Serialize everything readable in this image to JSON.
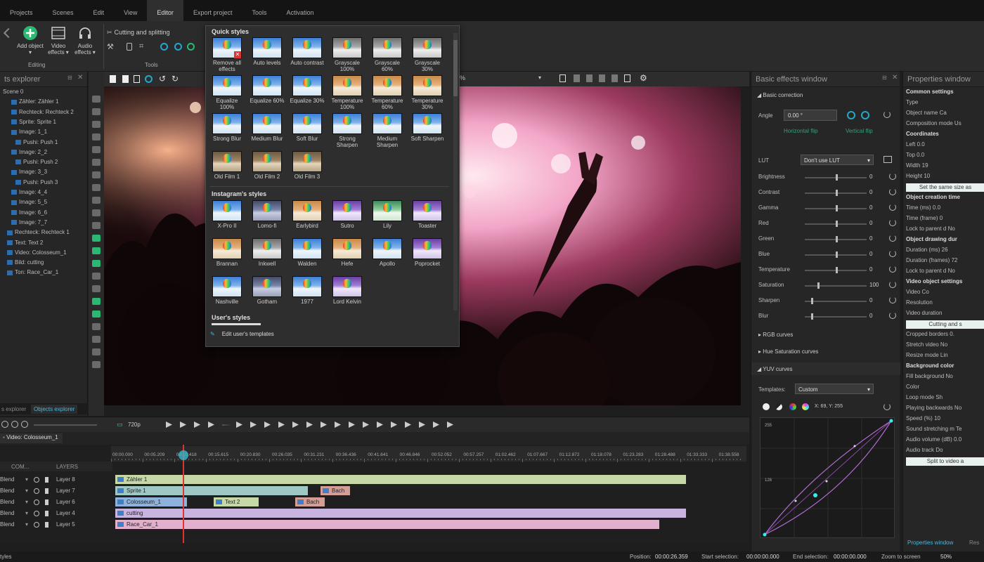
{
  "menu": [
    "Projects",
    "Scenes",
    "Edit",
    "View",
    "Editor",
    "Export project",
    "Tools",
    "Activation"
  ],
  "menu_active": "Editor",
  "ribbon": {
    "add_object": "Add object ▾",
    "video_effects": "Video effects ▾",
    "audio_effects": "Audio effects ▾",
    "editing_label": "Editing",
    "cutting_label": "Cutting and splitting",
    "tools_label": "Tools"
  },
  "scene_panel": {
    "title": "ts explorer",
    "items": [
      "Scene 0",
      "Zähler: Zähler 1",
      "Rechteck: Rechteck 2",
      "Sprite: Sprite 1",
      "Image: 1_1",
      "Pushi: Push 1",
      "Image: 2_2",
      "Pushi: Push 2",
      "Image: 3_3",
      "Pushi: Push 3",
      "Image: 4_4",
      "Image: 5_5",
      "Image: 6_6",
      "Image: 7_7",
      "Rechteck: Rechteck 1",
      "Text: Text 2",
      "Video: Colosseum_1",
      "Bild: cutting",
      "Ton: Race_Car_1"
    ],
    "tabs": [
      "s explorer",
      "Objects explorer"
    ]
  },
  "popup": {
    "quick_title": "Quick styles",
    "quick": [
      "Remove all effects",
      "Auto levels",
      "Auto contrast",
      "Grayscale 100%",
      "Grayscale 60%",
      "Grayscale 30%",
      "Equalize 100%",
      "Equalize 60%",
      "Equalize 30%",
      "Temperature 100%",
      "Temperature 60%",
      "Temperature 30%",
      "Strong Blur",
      "Medium Blur",
      "Soft Blur",
      "Strong Sharpen",
      "Medium Sharpen",
      "Soft Sharpen",
      "Old Film 1",
      "Old Film 2",
      "Old Film 3"
    ],
    "insta_title": "Instagram's styles",
    "insta": [
      "X-Pro II",
      "Lomo-fi",
      "Earlybird",
      "Sutro",
      "Lily",
      "Toaster",
      "Brannan",
      "Inkwell",
      "Walden",
      "Hefe",
      "Apollo",
      "Poprocket",
      "Nashville",
      "Gotham",
      "1977",
      "Lord Kelvin"
    ],
    "user_title": "User's styles",
    "edit_templates": "Edit user's templates"
  },
  "basic_effects": {
    "title": "Basic effects window",
    "section": "Basic correction",
    "angle_label": "Angle",
    "angle_value": "0.00 °",
    "horizontal_flip": "Horizontal flip",
    "vertical_flip": "Vertical flip",
    "lut_label": "LUT",
    "lut_value": "Don't use LUT",
    "sliders": [
      {
        "label": "Brightness",
        "value": "0",
        "pos": 0.5
      },
      {
        "label": "Contrast",
        "value": "0",
        "pos": 0.5
      },
      {
        "label": "Gamma",
        "value": "0",
        "pos": 0.5
      },
      {
        "label": "Red",
        "value": "0",
        "pos": 0.5
      },
      {
        "label": "Green",
        "value": "0",
        "pos": 0.5
      },
      {
        "label": "Blue",
        "value": "0",
        "pos": 0.5
      },
      {
        "label": "Temperature",
        "value": "0",
        "pos": 0.5
      },
      {
        "label": "Saturation",
        "value": "100",
        "pos": 0.2
      },
      {
        "label": "Sharpen",
        "value": "0",
        "pos": 0.1
      },
      {
        "label": "Blur",
        "value": "0",
        "pos": 0.1
      }
    ],
    "rgb_curves": "RGB curves",
    "hue_sat": "Hue Saturation curves",
    "yuv_curves": "YUV curves",
    "templates_label": "Templates:",
    "templates_value": "Custom",
    "coord": "X: 69, Y: 255",
    "curve_top": "255",
    "curve_mid": "128"
  },
  "properties": {
    "title": "Properties window",
    "rows": [
      {
        "t": "Common settings",
        "k": "hd"
      },
      {
        "t": "Type",
        "k": ""
      },
      {
        "t": "Object name     Ca",
        "k": ""
      },
      {
        "t": "Composition mode  Us",
        "k": ""
      },
      {
        "t": "Coordinates",
        "k": "hd"
      },
      {
        "t": "Left            0.0",
        "k": ""
      },
      {
        "t": "Top             0.0",
        "k": ""
      },
      {
        "t": "Width           19",
        "k": ""
      },
      {
        "t": "Height          10",
        "k": ""
      },
      {
        "t": "Set the same size as",
        "k": "btn"
      },
      {
        "t": "Object creation time",
        "k": "hd"
      },
      {
        "t": "Time (ms)       0.0",
        "k": ""
      },
      {
        "t": "Time (frame)    0",
        "k": ""
      },
      {
        "t": "Lock to parent d  No",
        "k": ""
      },
      {
        "t": "Object drawing dur",
        "k": "hd"
      },
      {
        "t": "Duration (ms)   26",
        "k": ""
      },
      {
        "t": "Duration (frames)  72",
        "k": ""
      },
      {
        "t": "Lock to parent d  No",
        "k": ""
      },
      {
        "t": "Video object settings",
        "k": "hd"
      },
      {
        "t": "Video           Co",
        "k": ""
      },
      {
        "t": "Resolution",
        "k": ""
      },
      {
        "t": "Video duration",
        "k": ""
      },
      {
        "t": "Cutting and s",
        "k": "btn"
      },
      {
        "t": "Cropped borders  0.",
        "k": ""
      },
      {
        "t": "Stretch video   No",
        "k": ""
      },
      {
        "t": "Resize mode     Lin",
        "k": ""
      },
      {
        "t": "Background color",
        "k": "hd"
      },
      {
        "t": "Fill background  No",
        "k": ""
      },
      {
        "t": "Color",
        "k": ""
      },
      {
        "t": "Loop mode       Sh",
        "k": ""
      },
      {
        "t": "Playing backwards  No",
        "k": ""
      },
      {
        "t": "Speed (%)       10",
        "k": ""
      },
      {
        "t": "Sound stretching m  Te",
        "k": ""
      },
      {
        "t": "Audio volume (dB)  0.0",
        "k": ""
      },
      {
        "t": "Audio track     Do",
        "k": ""
      },
      {
        "t": "Split to video a",
        "k": "btn"
      }
    ],
    "tab_label": "Properties window",
    "tab2": "Res"
  },
  "timeline": {
    "zoom": "720p",
    "tab": "Video: Colosseum_1",
    "ticks": [
      "00:00.000",
      "00:05.209",
      "00:10.418",
      "00:15.615",
      "00:20.830",
      "00:26.035",
      "00:31.231",
      "00:36.436",
      "00:41.641",
      "00:46.846",
      "00:52.052",
      "00:57.257",
      "01:02.462",
      "01:07.667",
      "01:12.872",
      "01:18.078",
      "01:23.283",
      "01:28.488",
      "01:33.333",
      "01:38.558"
    ],
    "header_blend": "COM...",
    "header_layers": "LAYERS",
    "layers": [
      "Layer 8",
      "Layer 7",
      "Layer 6",
      "Layer 4",
      "Layer 5"
    ],
    "blend": "Blend",
    "clips": [
      {
        "label": "Zähler 1",
        "color": "#c6d8a6"
      },
      {
        "label": "Sprite 1",
        "color": "#9fc7c4"
      },
      {
        "label": "Bach",
        "color": "#d49d96"
      },
      {
        "label": "Colosseum_1",
        "color": "#8db3dc"
      },
      {
        "label": "Text 2",
        "color": "#c6d8a6"
      },
      {
        "label": "Bach",
        "color": "#d49d96"
      },
      {
        "label": "cutting",
        "color": "#c9b4e0"
      },
      {
        "label": "Race_Car_1",
        "color": "#e2b0cd"
      }
    ]
  },
  "status": {
    "left": "tyles",
    "position_label": "Position:",
    "position": "00:00:26.359",
    "start_label": "Start selection:",
    "start": "00:00:00.000",
    "end_label": "End selection:",
    "end": "00:00:00.000",
    "zoom_label": "Zoom to screen",
    "zoom": "50%"
  },
  "colors": {
    "accent": "#2bb873",
    "panel": "#262626",
    "clip_blue": "#2a6db0"
  }
}
